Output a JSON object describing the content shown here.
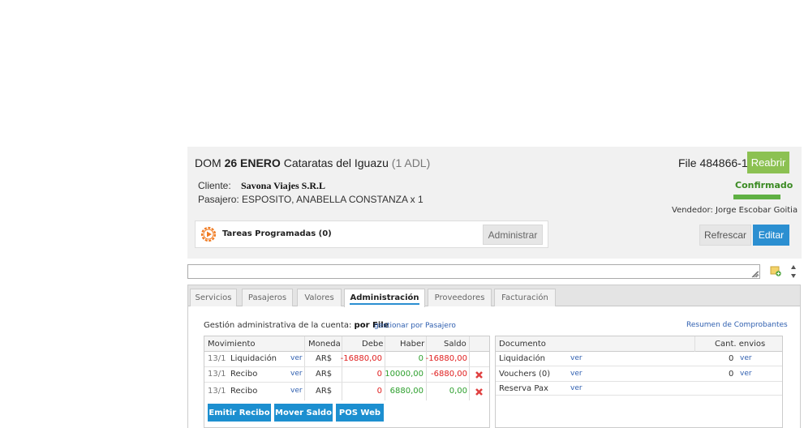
{
  "header": {
    "prefix": "DOM",
    "date_bold": "26 ENERO",
    "destination": "Cataratas del Iguazu",
    "pax": "(1 ADL)",
    "file_label": "File 484866-1",
    "reabrir_label": "Reabrir",
    "cliente_label": "Cliente:",
    "cliente_value": "Savona Viajes S.R.L",
    "pasajero_line": "Pasajero: ESPOSITO, ANABELLA CONSTANZA x 1",
    "status": "Confirmado",
    "vendedor": "Vendedor: Jorge Escobar Goitia",
    "tareas_label": "Tareas Programadas (0)",
    "administrar_label": "Administrar",
    "refrescar_label": "Refrescar",
    "editar_label": "Editar"
  },
  "tabs": [
    "Servicios",
    "Pasajeros",
    "Valores",
    "Administración",
    "Proveedores",
    "Facturación"
  ],
  "admin": {
    "gestion_text": "Gestión administrativa de la cuenta:",
    "gestion_bold": "por File",
    "gestion_link": "gestionar por Pasajero",
    "resumen_link": "Resumen de Comprobantes"
  },
  "movimientos": {
    "headers": [
      "Movimiento",
      "Moneda",
      "Debe",
      "Haber",
      "Saldo"
    ],
    "rows": [
      {
        "date": "13/1",
        "tipo": "Liquidación",
        "ver": "ver",
        "moneda": "AR$",
        "debe": "-16880,00",
        "haber": "0",
        "saldo": "-16880,00"
      },
      {
        "date": "13/1",
        "tipo": "Recibo",
        "ver": "ver",
        "moneda": "AR$",
        "debe": "0",
        "haber": "10000,00",
        "saldo": "-6880,00"
      },
      {
        "date": "13/1",
        "tipo": "Recibo",
        "ver": "ver",
        "moneda": "AR$",
        "debe": "0",
        "haber": "6880,00",
        "saldo": "0,00"
      }
    ],
    "buttons": [
      "Emitir Recibo",
      "Mover Saldo",
      "POS Web"
    ]
  },
  "documentos": {
    "headers": [
      "Documento",
      "Cant. envios"
    ],
    "rows": [
      {
        "doc": "Liquidación",
        "ver": "ver",
        "cant": "0",
        "ver2": "ver"
      },
      {
        "doc": "Vouchers (0)",
        "ver": "ver",
        "cant": "0",
        "ver2": "ver"
      },
      {
        "doc": "Reserva Pax",
        "ver": "ver",
        "cant": "",
        "ver2": ""
      }
    ]
  },
  "colors": {
    "green": "#8cc152",
    "blue": "#2b8fd1",
    "negative": "#e02020",
    "positive": "#2ea02e"
  },
  "icons": [
    "gear-play-icon",
    "resize-icon",
    "note-add-icon",
    "up-down-icon",
    "delete-x-icon"
  ]
}
